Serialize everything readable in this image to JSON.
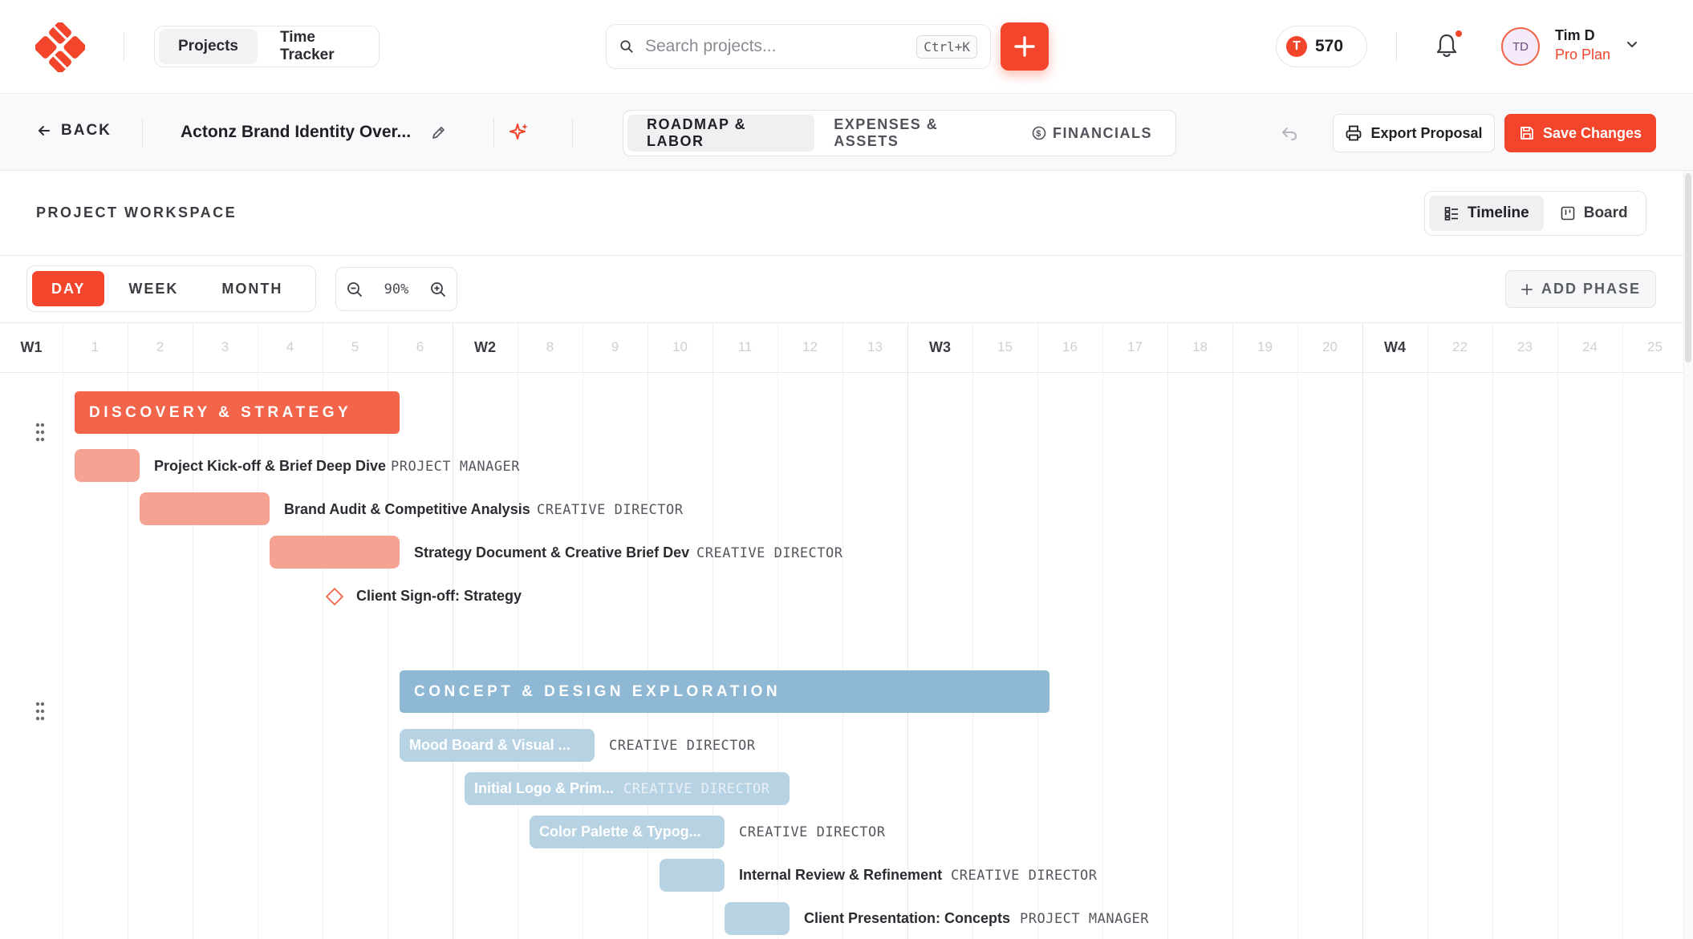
{
  "nav": {
    "tab_projects": "Projects",
    "tab_time_tracker": "Time Tracker"
  },
  "search": {
    "placeholder": "Search projects...",
    "shortcut": "Ctrl+K"
  },
  "tokens": {
    "icon_letter": "T",
    "value": "570"
  },
  "user": {
    "initials": "TD",
    "name": "Tim D",
    "plan": "Pro Plan"
  },
  "toolbar": {
    "back_label": "BACK",
    "project_title": "Actonz Brand Identity Over...",
    "tabs": [
      "ROADMAP & LABOR",
      "EXPENSES & ASSETS",
      "FINANCIALS"
    ],
    "export_label": "Export Proposal",
    "save_label": "Save Changes"
  },
  "workspace": {
    "label": "PROJECT WORKSPACE",
    "views": [
      "Timeline",
      "Board"
    ],
    "scales": [
      "DAY",
      "WEEK",
      "MONTH"
    ],
    "zoom": "90%",
    "add_phase_label": "ADD PHASE"
  },
  "timeline": {
    "columns": [
      "W1",
      "1",
      "2",
      "3",
      "4",
      "5",
      "6",
      "W2",
      "8",
      "9",
      "10",
      "11",
      "12",
      "13",
      "W3",
      "15",
      "16",
      "17",
      "18",
      "19",
      "20",
      "W4",
      "22",
      "23",
      "24",
      "25"
    ],
    "phases": [
      {
        "name": "DISCOVERY & STRATEGY",
        "color": "#f2654b",
        "tasks": [
          {
            "name": "Project Kick-off & Brief Deep Dive",
            "role": "PROJECT MANAGER"
          },
          {
            "name": "Brand Audit & Competitive Analysis",
            "role": "CREATIVE DIRECTOR"
          },
          {
            "name": "Strategy Document & Creative Brief Dev",
            "role": "CREATIVE DIRECTOR"
          },
          {
            "name": "Client Sign-off: Strategy",
            "role": ""
          }
        ]
      },
      {
        "name": "CONCEPT & DESIGN EXPLORATION",
        "color": "#8fb8d4",
        "tasks": [
          {
            "name": "Mood Board & Visual ...",
            "role": "CREATIVE DIRECTOR"
          },
          {
            "name": "Initial Logo & Prim...",
            "role": "CREATIVE DIRECTOR"
          },
          {
            "name": "Color Palette & Typog...",
            "role": "CREATIVE DIRECTOR"
          },
          {
            "name": "Internal Review & Refinement",
            "role": "CREATIVE DIRECTOR"
          },
          {
            "name": "Client Presentation: Concepts",
            "role": "PROJECT MANAGER"
          }
        ]
      }
    ]
  },
  "colors": {
    "accent": "#f2452b",
    "phase1": "#f2654b",
    "phase1_task": "#f5a293",
    "phase2": "#8fb8d4",
    "phase2_task": "#b7d2e3"
  }
}
